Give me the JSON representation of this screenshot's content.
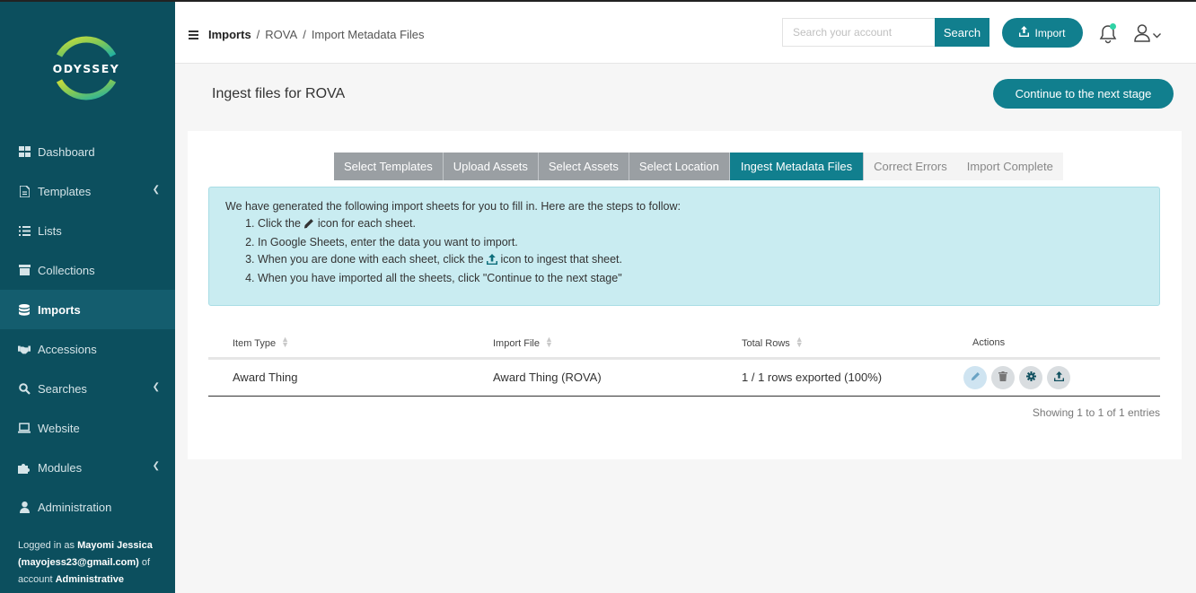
{
  "sidebar": {
    "logo_text": "ODYSSEY",
    "items": [
      {
        "label": "Dashboard",
        "icon": "dashboard-icon"
      },
      {
        "label": "Templates",
        "icon": "file-icon",
        "has_submenu": true
      },
      {
        "label": "Lists",
        "icon": "list-icon"
      },
      {
        "label": "Collections",
        "icon": "archive-icon"
      },
      {
        "label": "Imports",
        "icon": "database-icon",
        "active": true
      },
      {
        "label": "Accessions",
        "icon": "handshake-icon"
      },
      {
        "label": "Searches",
        "icon": "search-icon",
        "has_submenu": true
      },
      {
        "label": "Website",
        "icon": "laptop-icon"
      },
      {
        "label": "Modules",
        "icon": "puzzle-icon",
        "has_submenu": true
      },
      {
        "label": "Administration",
        "icon": "user-icon"
      }
    ],
    "login": {
      "prefix": "Logged in as ",
      "user": "Mayomi Jessica",
      "email": "(mayojess23@gmail.com)",
      "mid": " of account ",
      "account": "Administrative"
    }
  },
  "header": {
    "breadcrumb": [
      "Imports",
      "/",
      "ROVA",
      "/",
      "Import Metadata Files"
    ],
    "search_placeholder": "Search your account",
    "search_value": "",
    "search_button": "Search",
    "import_button": "Import"
  },
  "page": {
    "title": "Ingest files for ROVA",
    "continue_button": "Continue to the next stage"
  },
  "steps": [
    {
      "label": "Select Templates",
      "state": "done"
    },
    {
      "label": "Upload Assets",
      "state": "done"
    },
    {
      "label": "Select Assets",
      "state": "done"
    },
    {
      "label": "Select Location",
      "state": "done"
    },
    {
      "label": "Ingest Metadata Files",
      "state": "current"
    },
    {
      "label": "Correct Errors",
      "state": "future"
    },
    {
      "label": "Import Complete",
      "state": "future"
    }
  ],
  "info": {
    "intro": "We have generated the following import sheets for you to fill in. Here are the steps to follow:",
    "step1_a": "Click the ",
    "step1_b": " icon for each sheet.",
    "step2": "In Google Sheets, enter the data you want to import.",
    "step3_a": "When you are done with each sheet, click the ",
    "step3_b": " icon to ingest that sheet.",
    "step4": "When you have imported all the sheets, click \"Continue to the next stage\""
  },
  "table": {
    "headers": [
      "Item Type",
      "Import File",
      "Total Rows",
      "Actions"
    ],
    "rows": [
      {
        "item_type": "Award Thing",
        "import_file": "Award Thing (ROVA)",
        "total_rows": "1 / 1 rows exported (100%)"
      }
    ],
    "showing": "Showing 1 to 1 of 1 entries"
  },
  "colors": {
    "sidebar_bg": "#0c4f5e",
    "accent": "#117f8e",
    "info_bg": "#c9ecf1",
    "step_done": "#9a9fa3"
  }
}
